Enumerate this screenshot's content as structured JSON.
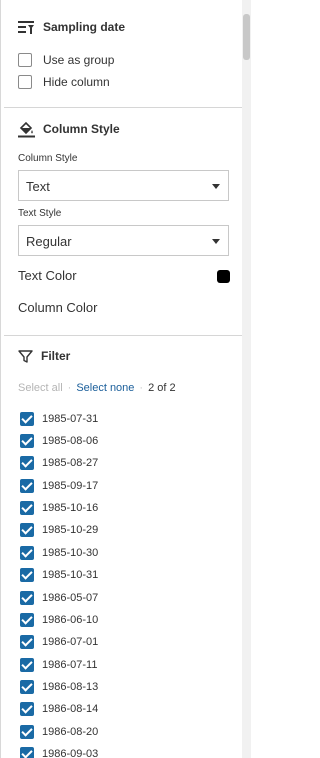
{
  "sampling": {
    "title": "Sampling date",
    "icon": "group-list-icon",
    "options": [
      {
        "label": "Use as group",
        "checked": false
      },
      {
        "label": "Hide column",
        "checked": false
      }
    ]
  },
  "column_style": {
    "title": "Column Style",
    "icon": "paint-bucket-icon",
    "style_label": "Column Style",
    "style_value": "Text",
    "text_style_label": "Text Style",
    "text_style_value": "Regular",
    "text_color_label": "Text Color",
    "text_color": "#000000",
    "column_color_label": "Column Color"
  },
  "filter": {
    "title": "Filter",
    "icon": "funnel-icon",
    "select_all": "Select all",
    "sep": "·",
    "select_none": "Select none",
    "count": "2 of 2",
    "items": [
      {
        "label": "1985-07-31",
        "checked": true
      },
      {
        "label": "1985-08-06",
        "checked": true
      },
      {
        "label": "1985-08-27",
        "checked": true
      },
      {
        "label": "1985-09-17",
        "checked": true
      },
      {
        "label": "1985-10-16",
        "checked": true
      },
      {
        "label": "1985-10-29",
        "checked": true
      },
      {
        "label": "1985-10-30",
        "checked": true
      },
      {
        "label": "1985-10-31",
        "checked": true
      },
      {
        "label": "1986-05-07",
        "checked": true
      },
      {
        "label": "1986-06-10",
        "checked": true
      },
      {
        "label": "1986-07-01",
        "checked": true
      },
      {
        "label": "1986-07-11",
        "checked": true
      },
      {
        "label": "1986-08-13",
        "checked": true
      },
      {
        "label": "1986-08-14",
        "checked": true
      },
      {
        "label": "1986-08-20",
        "checked": true
      },
      {
        "label": "1986-09-03",
        "checked": true
      }
    ]
  },
  "colors": {
    "accent": "#1a6aa5",
    "link": "#1a5e9a"
  }
}
